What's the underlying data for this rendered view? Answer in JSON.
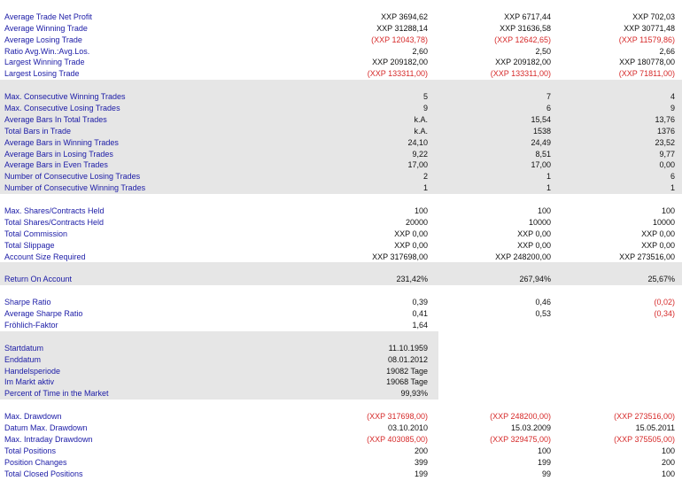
{
  "groups": [
    {
      "shade": "none",
      "rows": [
        {
          "label": "Average Trade Net Profit",
          "v0": "XXP 3694,62",
          "v1": "XXP 6717,44",
          "v2": "XXP 702,03"
        },
        {
          "label": "Average Winning Trade",
          "v0": "XXP 31288,14",
          "v1": "XXP 31636,58",
          "v2": "XXP 30771,48"
        },
        {
          "label": "Average Losing Trade",
          "v0": "(XXP 12043,78)",
          "v1": "(XXP 12642,65)",
          "v2": "(XXP 11579,86)"
        },
        {
          "label": "Ratio Avg.Win.:Avg.Los.",
          "v0": "2,60",
          "v1": "2,50",
          "v2": "2,66"
        },
        {
          "label": "Largest Winning Trade",
          "v0": "XXP 209182,00",
          "v1": "XXP 209182,00",
          "v2": "XXP 180778,00"
        },
        {
          "label": "Largest Losing Trade",
          "v0": "(XXP 133311,00)",
          "v1": "(XXP 133311,00)",
          "v2": "(XXP 71811,00)"
        }
      ]
    },
    {
      "shade": "full",
      "rows": [
        {
          "label": "Max. Consecutive Winning Trades",
          "v0": "5",
          "v1": "7",
          "v2": "4"
        },
        {
          "label": "Max. Consecutive Losing Trades",
          "v0": "9",
          "v1": "6",
          "v2": "9"
        },
        {
          "label": "Average Bars In Total Trades",
          "v0": "k.A.",
          "v1": "15,54",
          "v2": "13,76"
        },
        {
          "label": "Total Bars in Trade",
          "v0": "k.A.",
          "v1": "1538",
          "v2": "1376"
        },
        {
          "label": "Average Bars in Winning Trades",
          "v0": "24,10",
          "v1": "24,49",
          "v2": "23,52"
        },
        {
          "label": "Average Bars in Losing Trades",
          "v0": "9,22",
          "v1": "8,51",
          "v2": "9,77"
        },
        {
          "label": "Average Bars in Even Trades",
          "v0": "17,00",
          "v1": "17,00",
          "v2": "0,00"
        },
        {
          "label": "Number of Consecutive Losing Trades",
          "v0": "2",
          "v1": "1",
          "v2": "6"
        },
        {
          "label": "Number of Consecutive Winning Trades",
          "v0": "1",
          "v1": "1",
          "v2": "1"
        }
      ]
    },
    {
      "shade": "none",
      "rows": [
        {
          "label": "Max. Shares/Contracts Held",
          "v0": "100",
          "v1": "100",
          "v2": "100"
        },
        {
          "label": "Total Shares/Contracts Held",
          "v0": "20000",
          "v1": "10000",
          "v2": "10000"
        },
        {
          "label": "Total Commission",
          "v0": "XXP 0,00",
          "v1": "XXP 0,00",
          "v2": "XXP 0,00"
        },
        {
          "label": "Total Slippage",
          "v0": "XXP 0,00",
          "v1": "XXP 0,00",
          "v2": "XXP 0,00"
        },
        {
          "label": "Account Size Required",
          "v0": "XXP 317698,00",
          "v1": "XXP 248200,00",
          "v2": "XXP 273516,00"
        }
      ]
    },
    {
      "shade": "full",
      "rows": [
        {
          "label": "Return On Account",
          "v0": "231,42%",
          "v1": "267,94%",
          "v2": "25,67%"
        }
      ]
    },
    {
      "shade": "none",
      "rows": [
        {
          "label": "Sharpe Ratio",
          "v0": "0,39",
          "v1": "0,46",
          "v2": "(0,02)"
        },
        {
          "label": "Average Sharpe Ratio",
          "v0": "0,41",
          "v1": "0,53",
          "v2": "(0,34)"
        },
        {
          "label": "Fröhlich-Faktor",
          "v0": "1,64",
          "v1": "",
          "v2": ""
        }
      ]
    },
    {
      "shade": "partial",
      "rows": [
        {
          "label": "Startdatum",
          "v0": "11.10.1959",
          "v1": "",
          "v2": ""
        },
        {
          "label": "Enddatum",
          "v0": "08.01.2012",
          "v1": "",
          "v2": ""
        },
        {
          "label": "Handelsperiode",
          "v0": "19082 Tage",
          "v1": "",
          "v2": ""
        },
        {
          "label": "Im Markt aktiv",
          "v0": "19068 Tage",
          "v1": "",
          "v2": ""
        },
        {
          "label": "Percent of Time in the Market",
          "v0": "99,93%",
          "v1": "",
          "v2": ""
        }
      ]
    },
    {
      "shade": "none",
      "rows": [
        {
          "label": "Max. Drawdown",
          "v0": "(XXP 317698,00)",
          "v1": "(XXP 248200,00)",
          "v2": "(XXP 273516,00)"
        },
        {
          "label": "Datum Max. Drawdown",
          "v0": "03.10.2010",
          "v1": "15.03.2009",
          "v2": "15.05.2011"
        },
        {
          "label": "Max. Intraday Drawdown",
          "v0": "(XXP 403085,00)",
          "v1": "(XXP 329475,00)",
          "v2": "(XXP 375505,00)"
        },
        {
          "label": "Total Positions",
          "v0": "200",
          "v1": "100",
          "v2": "100"
        },
        {
          "label": "Position Changes",
          "v0": "399",
          "v1": "199",
          "v2": "200"
        },
        {
          "label": "Total Closed Positions",
          "v0": "199",
          "v1": "99",
          "v2": "100"
        }
      ]
    }
  ],
  "colors": {
    "label": "#1a1aa6",
    "value": "#111111",
    "negative": "#d62a2a",
    "shade": "#e6e6e6",
    "background": "#ffffff"
  }
}
